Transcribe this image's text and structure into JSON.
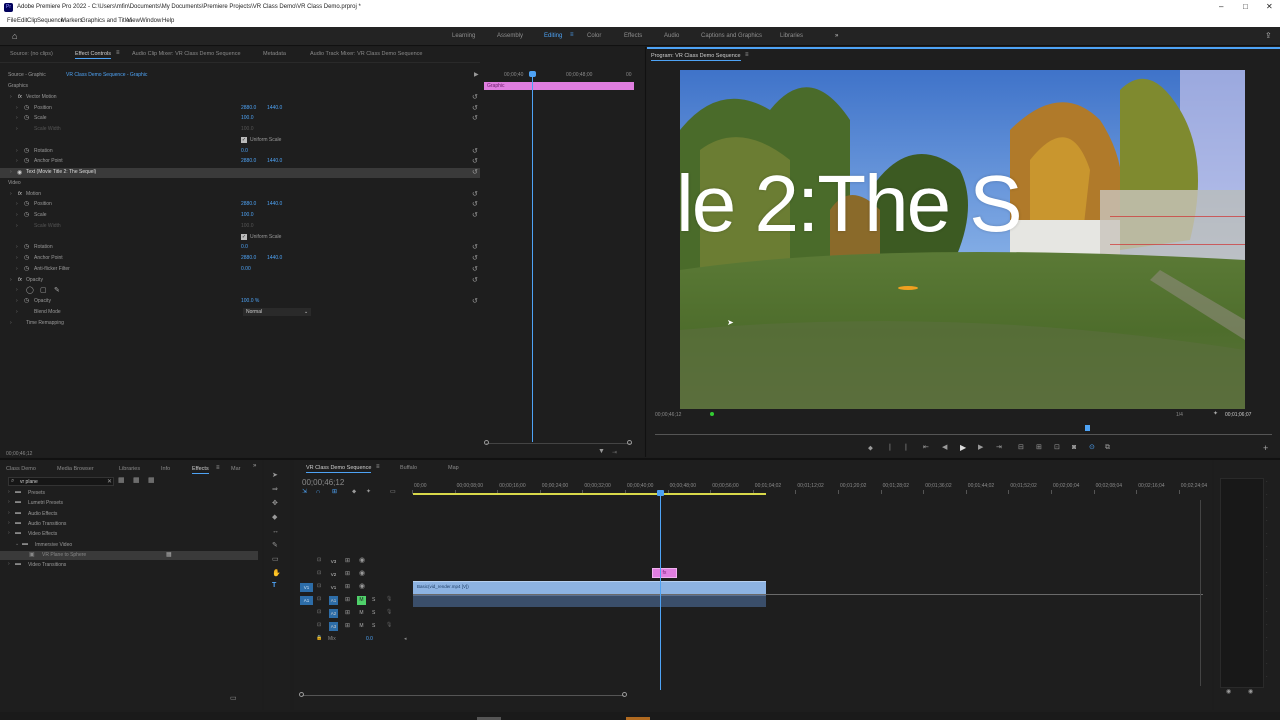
{
  "app": {
    "title": "Adobe Premiere Pro 2022 - C:\\Users\\mfin\\Documents\\My Documents\\Premiere Projects\\VR Class Demo\\VR Class Demo.prproj *",
    "menu": [
      "File",
      "Edit",
      "Clip",
      "Sequence",
      "Markers",
      "Graphics and Titles",
      "View",
      "Window",
      "Help"
    ]
  },
  "workspaces": {
    "tabs": [
      "Learning",
      "Assembly",
      "Editing",
      "Color",
      "Effects",
      "Audio",
      "Captions and Graphics",
      "Libraries"
    ],
    "active": "Editing",
    "more": "»"
  },
  "source_panel": {
    "tabs": [
      "Source: (no clips)",
      "Effect Controls",
      "Audio Clip Mixer: VR Class Demo Sequence",
      "Metadata",
      "Audio Track Mixer: VR Class Demo Sequence"
    ],
    "active_tab": "Effect Controls",
    "source_label": "Source - Graphic",
    "seq_label": "VR Class Demo Sequence - Graphic",
    "mini_ruler": [
      "00;00;40",
      "00;00;48;00",
      "00"
    ],
    "clip_name": "Graphic",
    "timecode": "00;00;46;12",
    "rows": [
      {
        "label": "Graphics",
        "indent": 0
      },
      {
        "label": "Vector Motion",
        "indent": 1,
        "fx": true
      },
      {
        "label": "Position",
        "indent": 2,
        "v1": "2880.0",
        "v2": "1440.0"
      },
      {
        "label": "Scale",
        "indent": 2,
        "v1": "100.0"
      },
      {
        "label": "Scale Width",
        "indent": 2,
        "v1": "100.0",
        "dim": true
      },
      {
        "label": "Uniform Scale",
        "indent": 3,
        "check": true
      },
      {
        "label": "Rotation",
        "indent": 2,
        "v1": "0.0"
      },
      {
        "label": "Anchor Point",
        "indent": 2,
        "v1": "2880.0",
        "v2": "1440.0"
      },
      {
        "label": "Text (Movie Title 2: The Sequel)",
        "indent": 1,
        "highlight": true
      },
      {
        "label": "Video",
        "indent": 0
      },
      {
        "label": "Motion",
        "indent": 1,
        "fx": true
      },
      {
        "label": "Position",
        "indent": 2,
        "v1": "2880.0",
        "v2": "1440.0"
      },
      {
        "label": "Scale",
        "indent": 2,
        "v1": "100.0"
      },
      {
        "label": "Scale Width",
        "indent": 2,
        "v1": "100.0",
        "dim": true
      },
      {
        "label": "Uniform Scale",
        "indent": 3,
        "check": true
      },
      {
        "label": "Rotation",
        "indent": 2,
        "v1": "0.0"
      },
      {
        "label": "Anchor Point",
        "indent": 2,
        "v1": "2880.0",
        "v2": "1440.0"
      },
      {
        "label": "Anti-flicker Filter",
        "indent": 2,
        "v1": "0.00"
      },
      {
        "label": "Opacity",
        "indent": 1,
        "fx": true
      },
      {
        "label": "",
        "indent": 2,
        "masks": true
      },
      {
        "label": "Opacity",
        "indent": 2,
        "v1": "100.0 %"
      },
      {
        "label": "Blend Mode",
        "indent": 2,
        "select": "Normal"
      },
      {
        "label": "Time Remapping",
        "indent": 1
      }
    ]
  },
  "program": {
    "title": "Program: VR Class Demo Sequence",
    "overlay_text": "le 2:The S",
    "timecode": "00;00;46;12",
    "fit": "1/4",
    "duration": "00;01;06;07",
    "playhead_fraction": 0.7
  },
  "project_panel": {
    "tabs": [
      "Class Demo",
      "Media Browser",
      "Libraries",
      "Info",
      "Effects",
      "Mar"
    ],
    "active_tab": "Effects",
    "search_value": "vr plane",
    "tree": [
      {
        "label": "Presets",
        "indent": 0
      },
      {
        "label": "Lumetri Presets",
        "indent": 0
      },
      {
        "label": "Audio Effects",
        "indent": 0
      },
      {
        "label": "Audio Transitions",
        "indent": 0
      },
      {
        "label": "Video Effects",
        "indent": 0
      },
      {
        "label": "Immersive Video",
        "indent": 1
      },
      {
        "label": "VR Plane to Sphere",
        "indent": 2,
        "selected": true
      },
      {
        "label": "Video Transitions",
        "indent": 0
      }
    ]
  },
  "timeline": {
    "tabs": [
      "VR Class Demo Sequence",
      "Buffalo",
      "Map"
    ],
    "timecode": "00;00;46;12",
    "ruler": [
      "00;00",
      "00;00;08;00",
      "00;00;16;00",
      "00;00;24;00",
      "00;00;32;00",
      "00;00;40;00",
      "00;00;48;00",
      "00;00;56;00",
      "00;01;04;02",
      "00;01;12;02",
      "00;01;20;02",
      "00;01;28;02",
      "00;01;36;02",
      "00;01;44;02",
      "00;01;52;02",
      "00;02;00;04",
      "00;02;08;04",
      "00;02;16;04",
      "00;02;24;04"
    ],
    "tracks": [
      {
        "name": "V3"
      },
      {
        "name": "V2"
      },
      {
        "name": "V1",
        "patch": "V1"
      },
      {
        "name": "A1",
        "patch": "A1",
        "m": "M",
        "s": "S"
      },
      {
        "name": "A2",
        "m": "M",
        "s": "S"
      },
      {
        "name": "A3",
        "m": "M",
        "s": "S"
      },
      {
        "name": "Mix",
        "value": "0.0"
      }
    ],
    "clips": {
      "graphic": "fx",
      "video": "Basic(vid_render.mp4 [V])"
    }
  },
  "colors": {
    "accent": "#4ea3f5",
    "clip_pink": "#e07ee0",
    "clip_blue": "#8db3e2",
    "bg": "#1d1d1d"
  }
}
